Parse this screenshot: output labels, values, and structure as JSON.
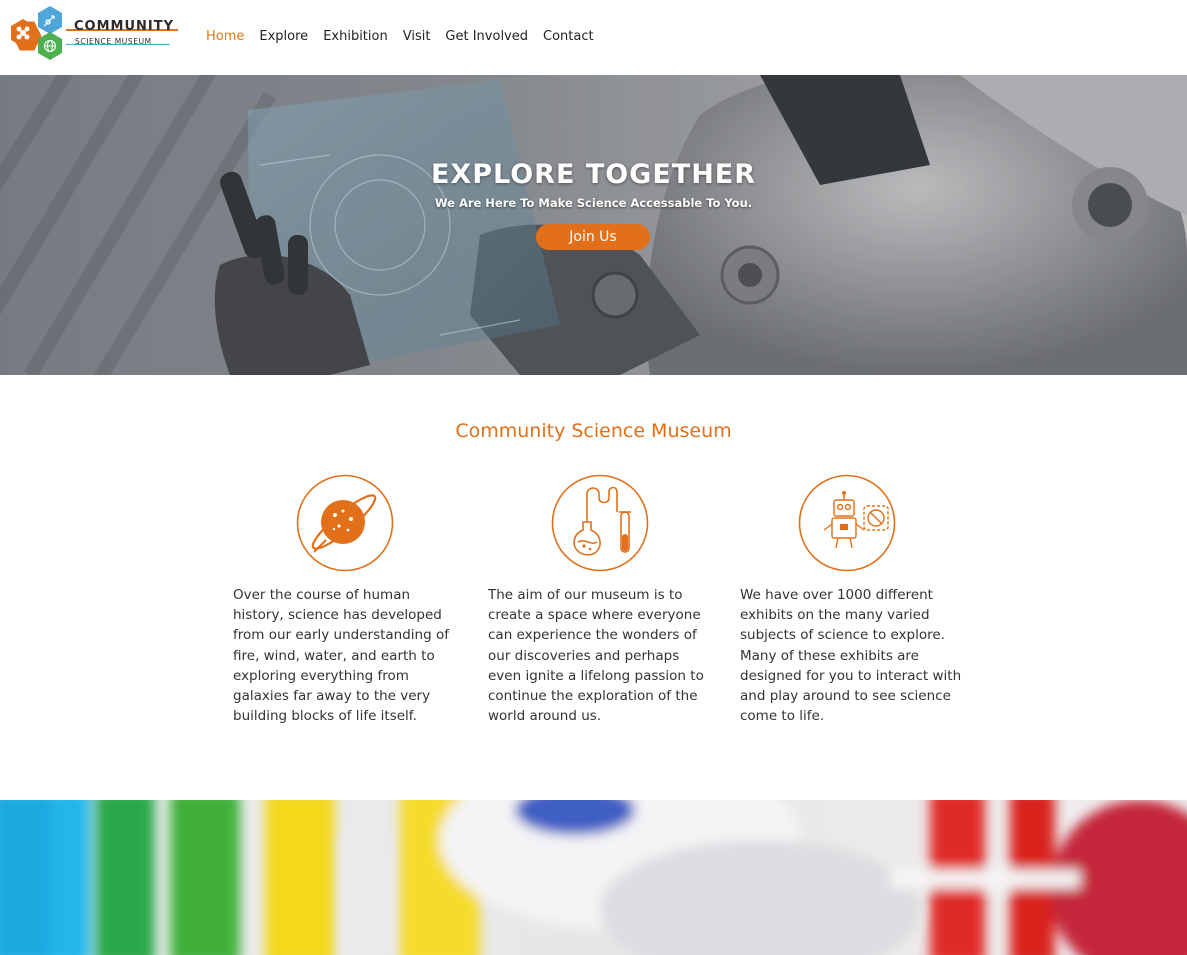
{
  "brand": {
    "title": "COMMUNITY",
    "subtitle": "SCIENCE MUSEUM",
    "logo_icon": "hexagon-logo-icon"
  },
  "nav": {
    "items": [
      {
        "label": "Home",
        "active": true
      },
      {
        "label": "Explore",
        "active": false
      },
      {
        "label": "Exhibition",
        "active": false
      },
      {
        "label": "Visit",
        "active": false
      },
      {
        "label": "Get Involved",
        "active": false
      },
      {
        "label": "Contact",
        "active": false
      }
    ]
  },
  "hero": {
    "title": "EXPLORE TOGETHER",
    "subtitle": "We Are Here To Make Science Accessable To You.",
    "button_label": "Join Us",
    "image": "robot-hero-image"
  },
  "intro": {
    "title": "Community Science Museum",
    "features": [
      {
        "icon": "planet-icon",
        "text": "Over the course of human history, science has developed from our early understanding of fire, wind, water, and earth to exploring everything from galaxies far away to the very building blocks of life itself."
      },
      {
        "icon": "flask-test-tube-icon",
        "text": "The aim of our museum is to create a space where everyone can experience the wonders of our discoveries and perhaps even ignite a lifelong passion to continue the exploration of the world around us."
      },
      {
        "icon": "robot-icon",
        "text": "We have over 1000 different exhibits on the many varied subjects of science to explore. Many of these exhibits are designed for you to interact with and play around to see science come to life."
      }
    ]
  },
  "banner": {
    "image": "test-tubes-banner-image"
  },
  "colors": {
    "accent": "#e2701a",
    "nav_active": "#e0781c",
    "text": "#333333",
    "logo_blue": "#4ea6d9",
    "logo_green": "#4caf50",
    "logo_orange": "#e2701a"
  }
}
